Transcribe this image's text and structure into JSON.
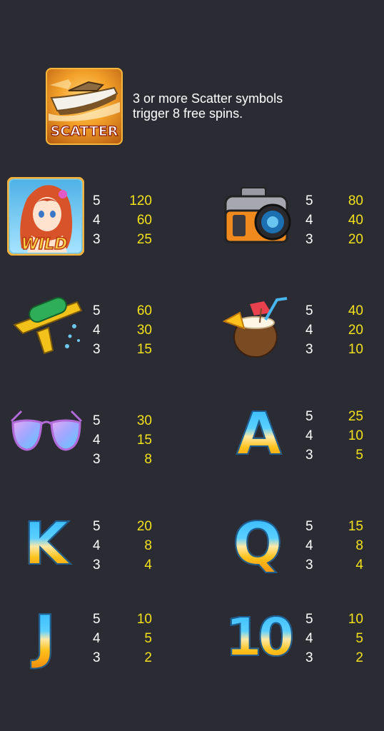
{
  "scatter": {
    "icon_label": "SCATTER",
    "icon": "speedboat-icon",
    "description_line1": "3 or more Scatter symbols",
    "description_line2": "trigger 8 free spins."
  },
  "colors": {
    "background": "#2b2b34",
    "count": "#ffffff",
    "payout": "#f3e21a"
  },
  "symbols": [
    {
      "icon": "wild-girl-icon",
      "label": "WILD",
      "pays": [
        {
          "count": "5",
          "value": "120"
        },
        {
          "count": "4",
          "value": "60"
        },
        {
          "count": "3",
          "value": "25"
        }
      ]
    },
    {
      "icon": "camera-icon",
      "pays": [
        {
          "count": "5",
          "value": "80"
        },
        {
          "count": "4",
          "value": "40"
        },
        {
          "count": "3",
          "value": "20"
        }
      ]
    },
    {
      "icon": "water-gun-icon",
      "pays": [
        {
          "count": "5",
          "value": "60"
        },
        {
          "count": "4",
          "value": "30"
        },
        {
          "count": "3",
          "value": "15"
        }
      ]
    },
    {
      "icon": "coconut-drink-icon",
      "pays": [
        {
          "count": "5",
          "value": "40"
        },
        {
          "count": "4",
          "value": "20"
        },
        {
          "count": "3",
          "value": "10"
        }
      ]
    },
    {
      "icon": "sunglasses-icon",
      "pays": [
        {
          "count": "5",
          "value": "30"
        },
        {
          "count": "4",
          "value": "15"
        },
        {
          "count": "3",
          "value": "8"
        }
      ]
    },
    {
      "icon": "letter-a-icon",
      "glyph": "A",
      "pays": [
        {
          "count": "5",
          "value": "25"
        },
        {
          "count": "4",
          "value": "10"
        },
        {
          "count": "3",
          "value": "5"
        }
      ]
    },
    {
      "icon": "letter-k-icon",
      "glyph": "K",
      "pays": [
        {
          "count": "5",
          "value": "20"
        },
        {
          "count": "4",
          "value": "8"
        },
        {
          "count": "3",
          "value": "4"
        }
      ]
    },
    {
      "icon": "letter-q-icon",
      "glyph": "Q",
      "pays": [
        {
          "count": "5",
          "value": "15"
        },
        {
          "count": "4",
          "value": "8"
        },
        {
          "count": "3",
          "value": "4"
        }
      ]
    },
    {
      "icon": "letter-j-icon",
      "glyph": "J",
      "pays": [
        {
          "count": "5",
          "value": "10"
        },
        {
          "count": "4",
          "value": "5"
        },
        {
          "count": "3",
          "value": "2"
        }
      ]
    },
    {
      "icon": "number-10-icon",
      "glyph": "10",
      "pays": [
        {
          "count": "5",
          "value": "10"
        },
        {
          "count": "4",
          "value": "5"
        },
        {
          "count": "3",
          "value": "2"
        }
      ]
    }
  ]
}
